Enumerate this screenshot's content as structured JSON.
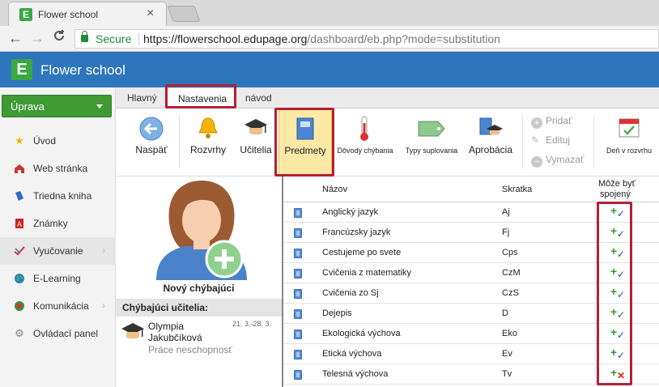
{
  "browser": {
    "tab_title": "Flower school",
    "tab_close": "×",
    "secure_label": "Secure",
    "url_main": "https://flowerschool.edupage.org",
    "url_path": "/dashboard/eb.php?mode=substitution",
    "back": "←",
    "forward": "→",
    "reload": "C"
  },
  "app": {
    "logo_letter": "E",
    "title": "Flower school",
    "brand_color": "#2e76bb",
    "accent_green": "#3f9a34"
  },
  "sidebar": {
    "edit_button": "Úprava",
    "items": [
      {
        "label": "Úvod",
        "icon": "star-icon"
      },
      {
        "label": "Web stránka",
        "icon": "house-icon"
      },
      {
        "label": "Triedna kniha",
        "icon": "book-icon"
      },
      {
        "label": "Známky",
        "icon": "grades-icon"
      },
      {
        "label": "Vyučovanie",
        "icon": "teaching-icon"
      },
      {
        "label": "E-Learning",
        "icon": "globe-icon"
      },
      {
        "label": "Komunikácia",
        "icon": "chat-icon"
      },
      {
        "label": "Ovládací panel",
        "icon": "gear-icon"
      }
    ]
  },
  "tabs": {
    "main": "Hlavný",
    "settings": "Nastavenia",
    "guide": "návod"
  },
  "toolbar": {
    "back": "Naspäť",
    "schedules": "Rozvrhy",
    "teachers": "Učitelia",
    "subjects": "Predmety",
    "absence_reasons": "Dôvody chýbania",
    "substitution_types": "Typy suplovania",
    "approbation": "Aprobácia",
    "add": "Pridať",
    "edit": "Edituj",
    "delete": "Vymazať",
    "day_in_schedule": "Deň v rozvrhu"
  },
  "absent": {
    "new_absent": "Nový chýbajúci",
    "absent_teachers_header": "Chýbajúci učitelia:",
    "teacher_first": "Olympia",
    "teacher_last": "Jakubčíková",
    "date_range": "21. 3.-28. 3.",
    "reason": "Práce neschopnosť"
  },
  "table": {
    "col_name": "Názov",
    "col_short": "Skratka",
    "col_combine_1": "Môže byť",
    "col_combine_2": "spojený",
    "rows": [
      {
        "name": "Anglický jazyk",
        "short": "Aj",
        "combinable": true
      },
      {
        "name": "Francúzsky jazyk",
        "short": "Fj",
        "combinable": true
      },
      {
        "name": "Cestujeme po svete",
        "short": "Cps",
        "combinable": true
      },
      {
        "name": "Cvičenia z matematiky",
        "short": "CzM",
        "combinable": true
      },
      {
        "name": "Cvičenia zo Sj",
        "short": "CzS",
        "combinable": true
      },
      {
        "name": "Dejepis",
        "short": "D",
        "combinable": true
      },
      {
        "name": "Ekologická výchova",
        "short": "Eko",
        "combinable": true
      },
      {
        "name": "Etická výchova",
        "short": "Ev",
        "combinable": true
      },
      {
        "name": "Telesná výchova",
        "short": "Tv",
        "combinable": false
      }
    ]
  }
}
